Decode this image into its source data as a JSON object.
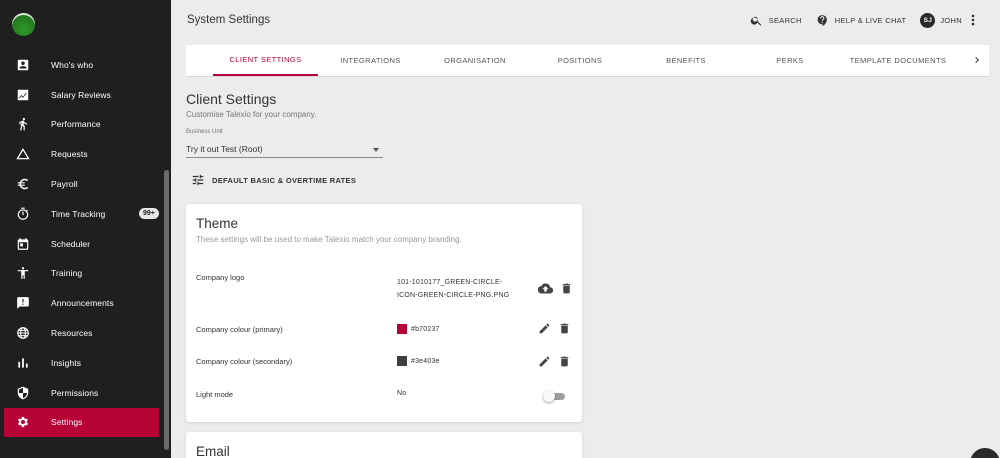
{
  "header": {
    "title": "System Settings",
    "search_label": "SEARCH",
    "help_label": "HELP & LIVE CHAT",
    "user_initials": "SJ",
    "user_name": "JOHN"
  },
  "sidebar": {
    "items": [
      {
        "label": "Who's who",
        "icon": "contact-card-icon"
      },
      {
        "label": "Salary Reviews",
        "icon": "salary-review-icon"
      },
      {
        "label": "Performance",
        "icon": "running-person-icon"
      },
      {
        "label": "Requests",
        "icon": "triangle-icon"
      },
      {
        "label": "Payroll",
        "icon": "euro-icon"
      },
      {
        "label": "Time Tracking",
        "icon": "stopwatch-icon",
        "badge": "99+"
      },
      {
        "label": "Scheduler",
        "icon": "calendar-icon"
      },
      {
        "label": "Training",
        "icon": "accessibility-icon"
      },
      {
        "label": "Announcements",
        "icon": "announcement-icon"
      },
      {
        "label": "Resources",
        "icon": "globe-icon"
      },
      {
        "label": "Insights",
        "icon": "bar-chart-icon"
      },
      {
        "label": "Permissions",
        "icon": "shield-icon"
      },
      {
        "label": "Settings",
        "icon": "gear-icon",
        "active": true
      }
    ]
  },
  "tabs": [
    {
      "label": "CLIENT SETTINGS",
      "active": true
    },
    {
      "label": "INTEGRATIONS"
    },
    {
      "label": "ORGANISATION"
    },
    {
      "label": "POSITIONS"
    },
    {
      "label": "BENEFITS"
    },
    {
      "label": "PERKS"
    },
    {
      "label": "TEMPLATE DOCUMENTS"
    }
  ],
  "client_settings": {
    "title": "Client Settings",
    "subtitle": "Customise Talexio for your company.",
    "business_unit_label": "Business Unit",
    "business_unit_value": "Try it out Test (Root)",
    "rates_button": "DEFAULT BASIC & OVERTIME RATES"
  },
  "theme": {
    "title": "Theme",
    "subtitle": "These settings will be used to make Talexio match your company branding.",
    "logo_label": "Company logo",
    "logo_file_line1": "101-1010177_GREEN-CIRCLE-",
    "logo_file_line2": "ICON-GREEN-CIRCLE-PNG.PNG",
    "primary_label": "Company colour (primary)",
    "primary_value": "#b70237",
    "secondary_label": "Company colour (secondary)",
    "secondary_value": "#3e403e",
    "light_mode_label": "Light mode",
    "light_mode_value": "No"
  },
  "email": {
    "title": "Email"
  },
  "colors": {
    "accent": "#b70237",
    "sidebar_bg": "#1f1f1f",
    "primary_swatch": "#b70237",
    "secondary_swatch": "#3e403e"
  }
}
